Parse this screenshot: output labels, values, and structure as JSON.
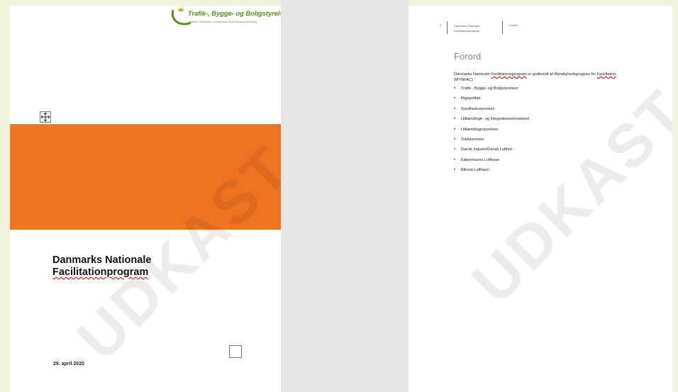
{
  "logo": {
    "name": "Trafik-, Bygge- og Boligstyrelsen",
    "subtitle": "Danish Transport, Construction and Housing Authority"
  },
  "cover": {
    "title_line1": "Danmarks Nationale",
    "title_line2": "Facilitationprogram",
    "date": "29. april 2020",
    "band_color": "#f07322"
  },
  "watermark": "UDKAST",
  "header": {
    "page_number": "3",
    "doc_line1": "Danmarks Nationale",
    "doc_line2": "Facilitationsprogram",
    "section": "Forord"
  },
  "foreword": {
    "heading": "Forord",
    "intro_part1": "Danmarks Nationale ",
    "intro_flag": "Facilitationsprogram",
    "intro_part2": " er godkendt af Myndighedsgruppen for ",
    "intro_flag2": "Facilitation",
    "intro_part3": " (MYNFAC)",
    "items": [
      "Trafik-, Bygge- og Boligstyrelsen",
      "Rigspolitiet",
      "Sundhedsstyrelsen",
      "Udlændinge- og Integrationsministeriet",
      "Udlændingestyrelsen",
      "Toldstyrelsen",
      "Dansk Industri/Dansk Luftfart",
      "Københavns Lufthavn",
      "Billund Lufthavn"
    ]
  }
}
